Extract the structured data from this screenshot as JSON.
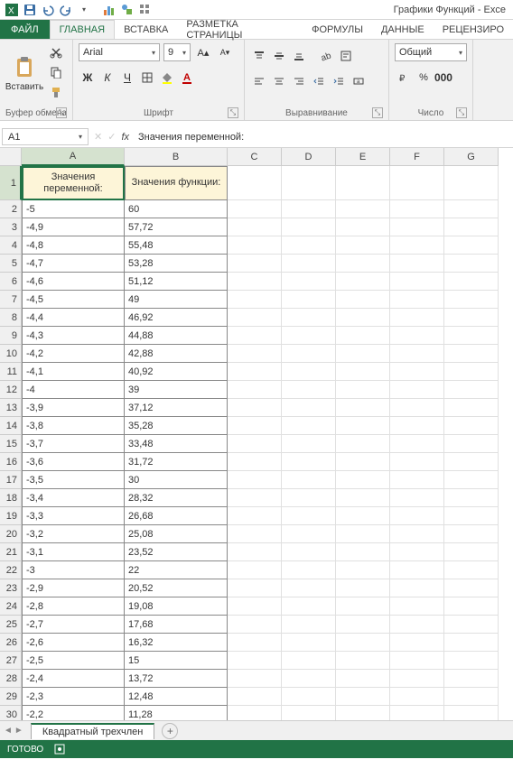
{
  "app": {
    "title": "Графики Функций - Exce"
  },
  "tabs": {
    "file": "ФАЙЛ",
    "items": [
      "ГЛАВНАЯ",
      "ВСТАВКА",
      "РАЗМЕТКА СТРАНИЦЫ",
      "ФОРМУЛЫ",
      "ДАННЫЕ",
      "РЕЦЕНЗИРО"
    ],
    "active": 0
  },
  "ribbon": {
    "clipboard": {
      "paste": "Вставить",
      "label": "Буфер обмена"
    },
    "font": {
      "name": "Arial",
      "size": "9",
      "label": "Шрифт",
      "bold": "Ж",
      "italic": "К",
      "underline": "Ч"
    },
    "align": {
      "label": "Выравнивание"
    },
    "number": {
      "format": "Общий",
      "label": "Число"
    }
  },
  "namebox": "A1",
  "formula": "Значения переменной:",
  "columns": [
    "A",
    "B",
    "C",
    "D",
    "E",
    "F",
    "G"
  ],
  "headers": {
    "A": "Значения переменной:",
    "B": "Значения функции:"
  },
  "rows": [
    {
      "n": 2,
      "a": "-5",
      "b": "60"
    },
    {
      "n": 3,
      "a": "-4,9",
      "b": "57,72"
    },
    {
      "n": 4,
      "a": "-4,8",
      "b": "55,48"
    },
    {
      "n": 5,
      "a": "-4,7",
      "b": "53,28"
    },
    {
      "n": 6,
      "a": "-4,6",
      "b": "51,12"
    },
    {
      "n": 7,
      "a": "-4,5",
      "b": "49"
    },
    {
      "n": 8,
      "a": "-4,4",
      "b": "46,92"
    },
    {
      "n": 9,
      "a": "-4,3",
      "b": "44,88"
    },
    {
      "n": 10,
      "a": "-4,2",
      "b": "42,88"
    },
    {
      "n": 11,
      "a": "-4,1",
      "b": "40,92"
    },
    {
      "n": 12,
      "a": "-4",
      "b": "39"
    },
    {
      "n": 13,
      "a": "-3,9",
      "b": "37,12"
    },
    {
      "n": 14,
      "a": "-3,8",
      "b": "35,28"
    },
    {
      "n": 15,
      "a": "-3,7",
      "b": "33,48"
    },
    {
      "n": 16,
      "a": "-3,6",
      "b": "31,72"
    },
    {
      "n": 17,
      "a": "-3,5",
      "b": "30"
    },
    {
      "n": 18,
      "a": "-3,4",
      "b": "28,32"
    },
    {
      "n": 19,
      "a": "-3,3",
      "b": "26,68"
    },
    {
      "n": 20,
      "a": "-3,2",
      "b": "25,08"
    },
    {
      "n": 21,
      "a": "-3,1",
      "b": "23,52"
    },
    {
      "n": 22,
      "a": "-3",
      "b": "22"
    },
    {
      "n": 23,
      "a": "-2,9",
      "b": "20,52"
    },
    {
      "n": 24,
      "a": "-2,8",
      "b": "19,08"
    },
    {
      "n": 25,
      "a": "-2,7",
      "b": "17,68"
    },
    {
      "n": 26,
      "a": "-2,6",
      "b": "16,32"
    },
    {
      "n": 27,
      "a": "-2,5",
      "b": "15"
    },
    {
      "n": 28,
      "a": "-2,4",
      "b": "13,72"
    },
    {
      "n": 29,
      "a": "-2,3",
      "b": "12,48"
    },
    {
      "n": 30,
      "a": "-2,2",
      "b": "11,28"
    }
  ],
  "sheet": {
    "name": "Квадратный трехчлен"
  },
  "status": {
    "ready": "ГОТОВО"
  }
}
